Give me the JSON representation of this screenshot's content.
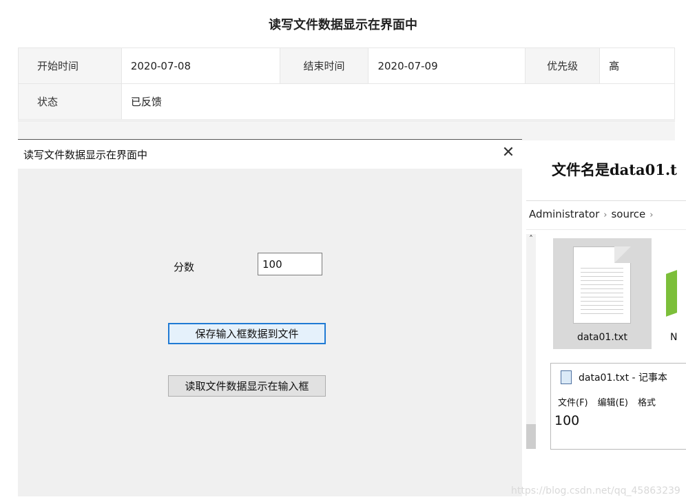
{
  "page": {
    "title": "读写文件数据显示在界面中"
  },
  "info": {
    "start_label": "开始时间",
    "start_value": "2020-07-08",
    "end_label": "结束时间",
    "end_value": "2020-07-09",
    "priority_label": "优先级",
    "priority_value": "高",
    "status_label": "状态",
    "status_value": "已反馈"
  },
  "dialog": {
    "title": "读写文件数据显示在界面中",
    "close_glyph": "✕",
    "score_label": "分数",
    "score_value": "100",
    "save_button": "保存输入框数据到文件",
    "read_button": "读取文件数据显示在输入框"
  },
  "explorer": {
    "heading": "文件名是data01.t",
    "breadcrumb": [
      "Administrator",
      "source"
    ],
    "breadcrumb_sep": "›",
    "file_name": "data01.txt",
    "second_tile_letter": "N"
  },
  "notepad": {
    "title": "data01.txt - 记事本",
    "menu": [
      "文件(F)",
      "编辑(E)",
      "格式"
    ],
    "content": "100"
  },
  "watermark": "https://blog.csdn.net/qq_45863239"
}
